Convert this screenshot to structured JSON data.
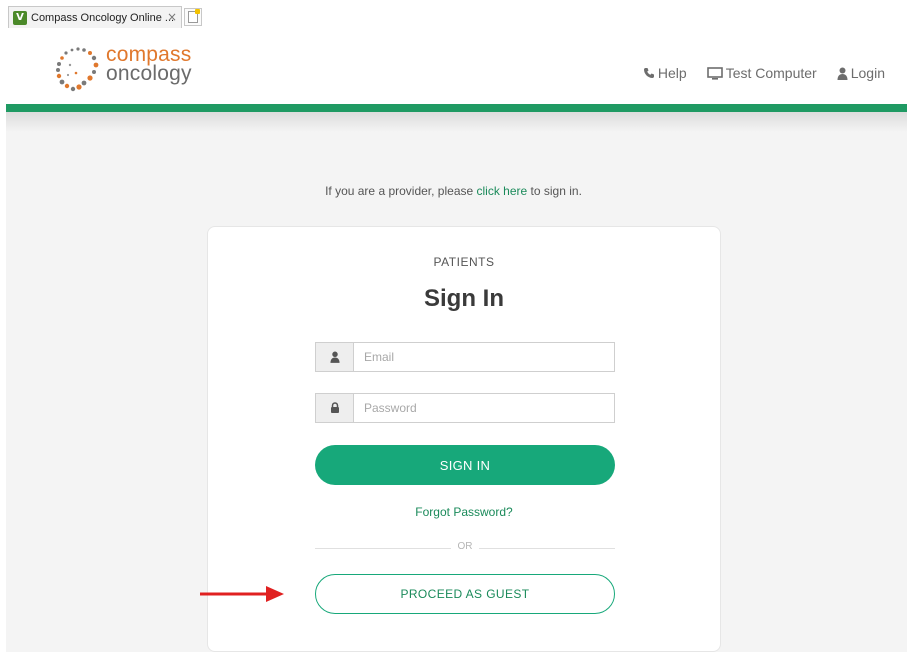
{
  "browser": {
    "tab_title": "Compass Oncology Online ...",
    "tab_close": "×",
    "favicon_letter": "V"
  },
  "header": {
    "logo": {
      "line1": "compass",
      "line2": "oncology"
    },
    "nav": [
      {
        "icon": "phone-icon",
        "label": "Help"
      },
      {
        "icon": "monitor-icon",
        "label": "Test Computer"
      },
      {
        "icon": "user-icon",
        "label": "Login"
      }
    ]
  },
  "provider": {
    "before": "If you are a provider, please ",
    "link": "click here",
    "after": " to sign in."
  },
  "card": {
    "eyebrow": "PATIENTS",
    "title": "Sign In",
    "email": {
      "placeholder": "Email",
      "value": ""
    },
    "password": {
      "placeholder": "Password",
      "value": ""
    },
    "sign_in_label": "SIGN IN",
    "forgot_label": "Forgot Password?",
    "or_label": "OR",
    "guest_label": "PROCEED AS GUEST"
  },
  "colors": {
    "accent": "#17a87a",
    "header_bar": "#1f9a63",
    "logo_orange": "#e0782d",
    "arrow": "#e02020"
  }
}
